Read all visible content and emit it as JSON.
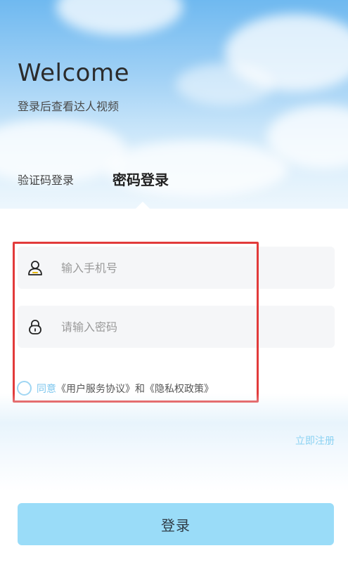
{
  "header": {
    "title": "Welcome",
    "subtitle": "登录后查看达人视频"
  },
  "tabs": [
    {
      "label": "验证码登录",
      "active": false
    },
    {
      "label": "密码登录",
      "active": true
    }
  ],
  "form": {
    "phone_placeholder": "输入手机号",
    "password_placeholder": "请输入密码",
    "phone_icon": "user-icon",
    "password_icon": "lock-icon"
  },
  "agreement": {
    "prefix": "同意",
    "user_agreement": "《用户服务协议》",
    "and": "和",
    "privacy_policy": "《隐私权政策》",
    "checked": false
  },
  "register_link": "立即注册",
  "login_button": "登录",
  "colors": {
    "accent": "#9adcf8",
    "link": "#8bd2f2",
    "highlight": "#e23b3b"
  }
}
